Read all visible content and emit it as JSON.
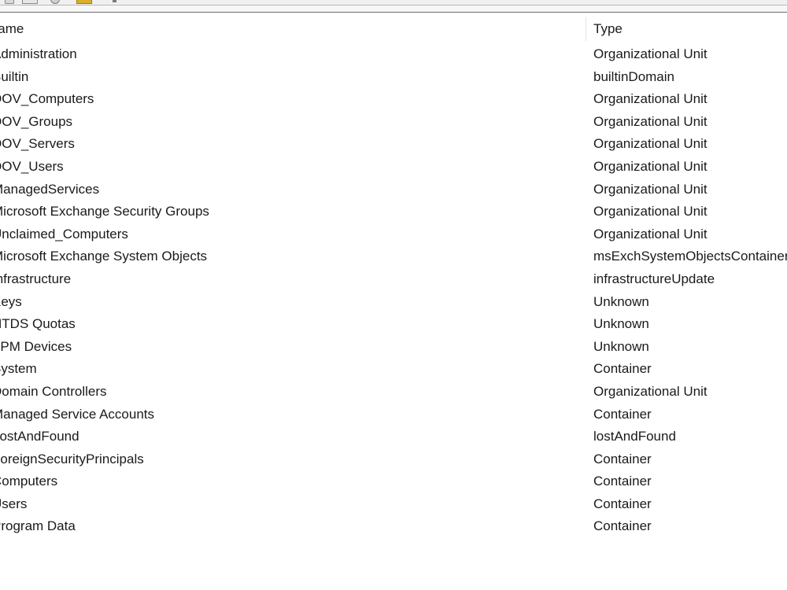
{
  "toolbar": {
    "icons": [
      "back-icon",
      "console-tree-icon",
      "refresh-icon",
      "folder-icon",
      "help-icon"
    ]
  },
  "list": {
    "columns": {
      "name": "Name",
      "type": "Type"
    },
    "rows": [
      {
        "name": "Administration",
        "type": "Organizational Unit"
      },
      {
        "name": "Builtin",
        "type": "builtinDomain"
      },
      {
        "name": "DOV_Computers",
        "type": "Organizational Unit"
      },
      {
        "name": "DOV_Groups",
        "type": "Organizational Unit"
      },
      {
        "name": "DOV_Servers",
        "type": "Organizational Unit"
      },
      {
        "name": "DOV_Users",
        "type": "Organizational Unit"
      },
      {
        "name": "ManagedServices",
        "type": "Organizational Unit"
      },
      {
        "name": "Microsoft Exchange Security Groups",
        "type": "Organizational Unit"
      },
      {
        "name": "Unclaimed_Computers",
        "type": "Organizational Unit"
      },
      {
        "name": "Microsoft Exchange System Objects",
        "type": "msExchSystemObjectsContainer"
      },
      {
        "name": "Infrastructure",
        "type": "infrastructureUpdate"
      },
      {
        "name": "Keys",
        "type": "Unknown"
      },
      {
        "name": "NTDS Quotas",
        "type": "Unknown"
      },
      {
        "name": "TPM Devices",
        "type": "Unknown"
      },
      {
        "name": "System",
        "type": "Container"
      },
      {
        "name": "Domain Controllers",
        "type": "Organizational Unit"
      },
      {
        "name": "Managed Service Accounts",
        "type": "Container"
      },
      {
        "name": "LostAndFound",
        "type": "lostAndFound"
      },
      {
        "name": "ForeignSecurityPrincipals",
        "type": "Container"
      },
      {
        "name": "Computers",
        "type": "Container"
      },
      {
        "name": "Users",
        "type": "Container"
      },
      {
        "name": "Program Data",
        "type": "Container"
      }
    ]
  }
}
